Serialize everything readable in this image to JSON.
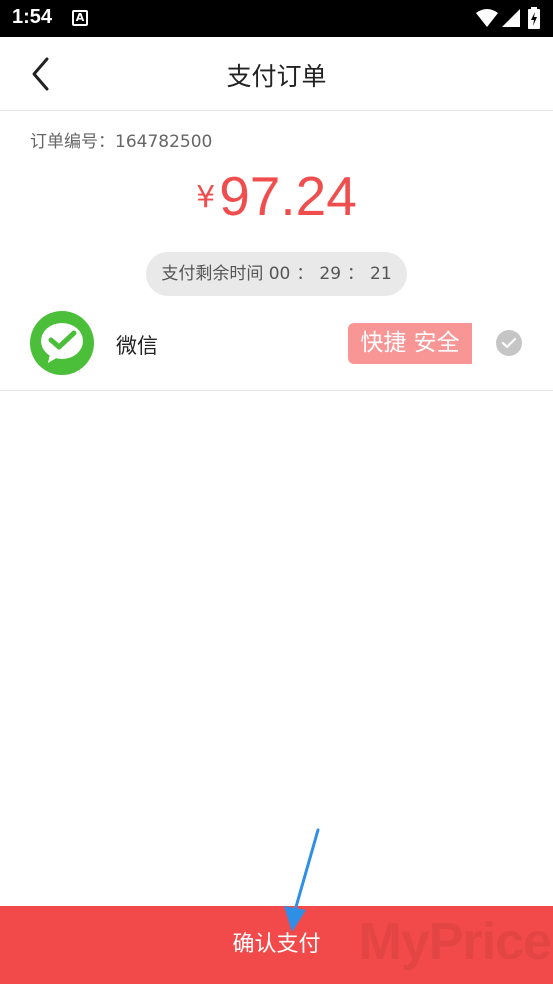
{
  "status_bar": {
    "time": "1:54",
    "app_icon_letter": "A"
  },
  "header": {
    "title": "支付订单",
    "back_icon": "chevron-left-icon"
  },
  "order": {
    "label": "订单编号：",
    "number": "164782500"
  },
  "amount": {
    "currency": "¥",
    "value": "97.24",
    "color": "#f04e4e"
  },
  "timer": {
    "label": "支付剩余时间",
    "hours": "00",
    "sep1": "：",
    "minutes": "29",
    "sep2": "：",
    "seconds": "21"
  },
  "payment_method": {
    "name": "微信",
    "badge": "快捷 安全",
    "icon": "wechat-icon",
    "selected": true
  },
  "confirm": {
    "label": "确认支付",
    "color": "#f24a4a"
  },
  "watermark": "MyPrice"
}
